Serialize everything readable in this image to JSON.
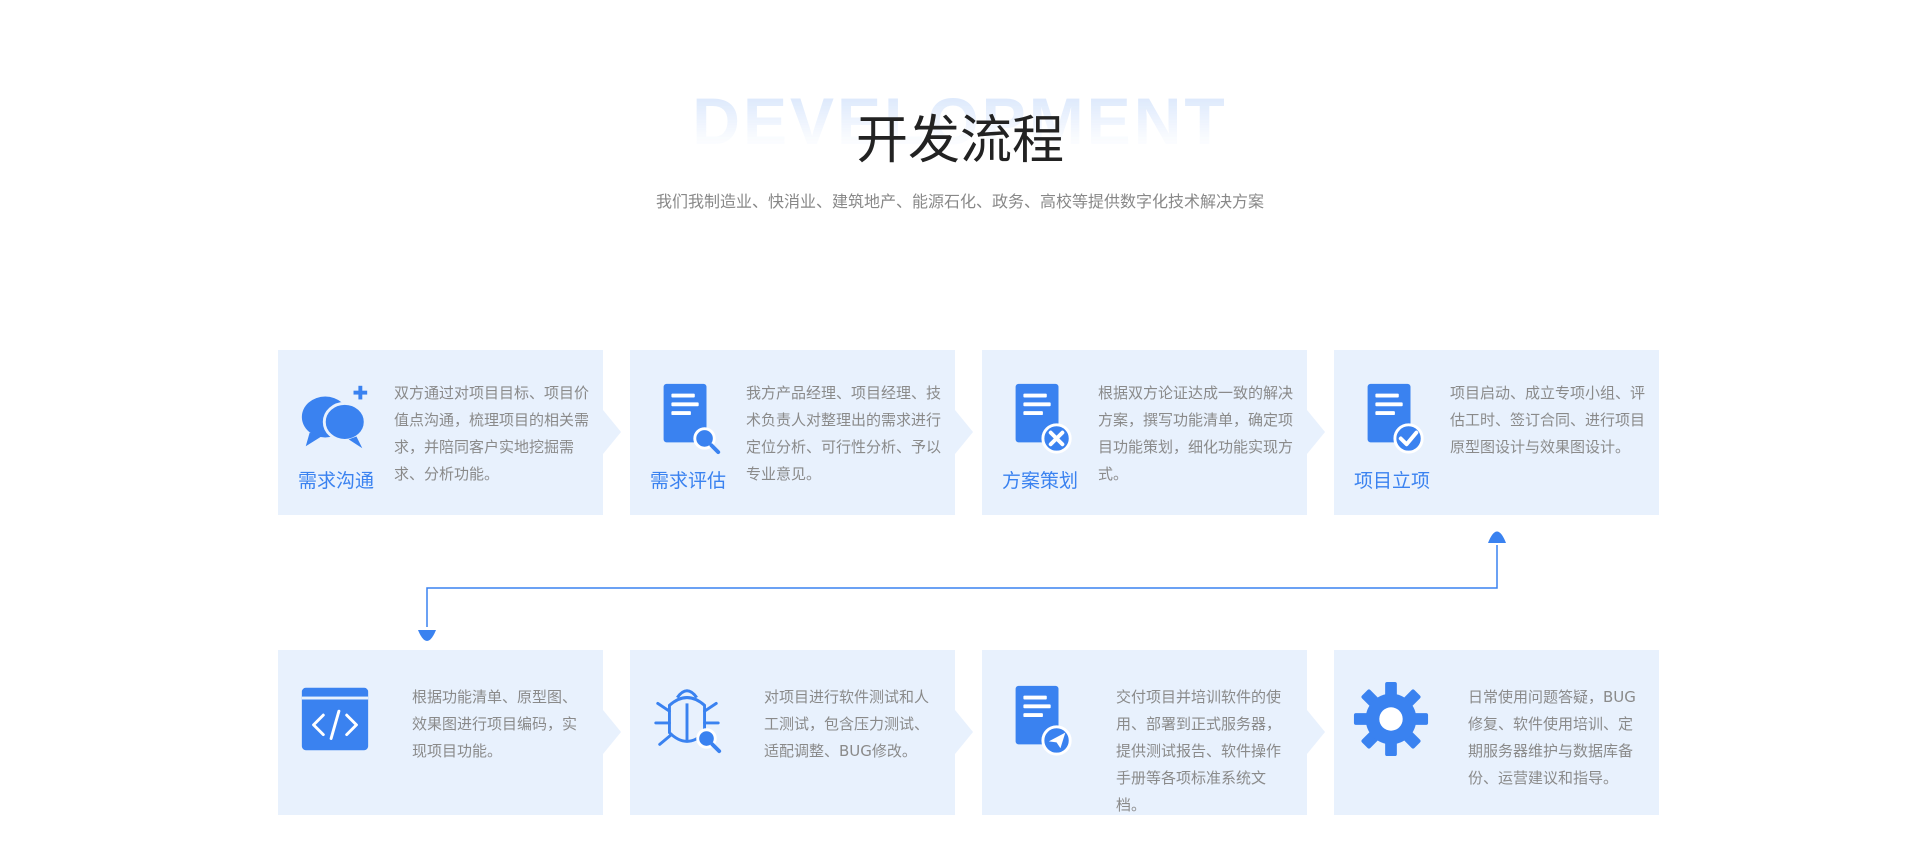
{
  "header": {
    "watermark": "DEVELOPMENT",
    "title": "开发流程",
    "subtitle": "我们我制造业、快消业、建筑地产、能源石化、政务、高校等提供数字化技术解决方案"
  },
  "colors": {
    "accent": "#3a82f0",
    "card_bg": "#e8f1fd",
    "title": "#222222",
    "text": "#8a8a8a",
    "watermark": "#cfe0fb"
  },
  "steps_top": [
    {
      "label": "需求沟通",
      "icon": "chat-bubbles-plus-icon",
      "desc": "双方通过对项目目标、项目价值点沟通，梳理项目的相关需求，并陪同客户实地挖掘需求、分析功能。"
    },
    {
      "label": "需求评估",
      "icon": "document-search-icon",
      "desc": "我方产品经理、项目经理、技术负责人对整理出的需求进行定位分析、可行性分析、予以专业意见。"
    },
    {
      "label": "方案策划",
      "icon": "document-edit-icon",
      "desc": "根据双方论证达成一致的解决方案，撰写功能清单，确定项目功能策划，细化功能实现方式。"
    },
    {
      "label": "项目立项",
      "icon": "document-check-icon",
      "desc": "项目启动、成立专项小组、评估工时、签订合同、进行项目原型图设计与效果图设计。"
    }
  ],
  "steps_bottom": [
    {
      "icon": "code-window-icon",
      "desc": "根据功能清单、原型图、效果图进行项目编码，实现项目功能。"
    },
    {
      "icon": "bug-search-icon",
      "desc": "对项目进行软件测试和人工测试，包含压力测试、适配调整、BUG修改。"
    },
    {
      "icon": "document-send-icon",
      "desc": "交付项目并培训软件的使用、部署到正式服务器，提供测试报告、软件操作手册等各项标准系统文档。"
    },
    {
      "icon": "gear-icon",
      "desc": "日常使用问题答疑，BUG修复、软件使用培训、定期服务器维护与数据库备份、运营建议和指导。"
    }
  ]
}
